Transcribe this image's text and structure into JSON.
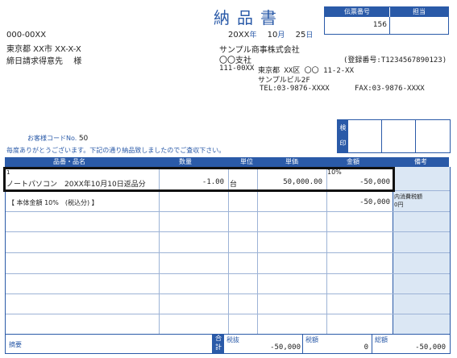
{
  "document": {
    "title": "納品書",
    "voucher": {
      "number_label": "伝票番号",
      "person_label": "担当",
      "number_value": "156"
    },
    "date": {
      "year": "20XX",
      "year_unit": "年",
      "month": "10",
      "month_unit": "月",
      "day": "25",
      "day_unit": "日"
    }
  },
  "recipient": {
    "postal": "000-00XX",
    "address": "東京都 XX市 XX-X-X",
    "name": "締日請求得意先",
    "honorific": "様"
  },
  "sender": {
    "company": "サンプル商事株式会社",
    "branch": "〇〇支社",
    "registration": "(登録番号:T1234567890123)",
    "postal": "111-00XX",
    "address_line1": "東京都 XX区 〇〇 11-2-XX",
    "address_line2": "サンプルビル2F",
    "tel": "TEL:03-9876-XXXX",
    "fax": "FAX:03-9876-XXXX"
  },
  "inspection": {
    "label_1": "検",
    "label_2": "印"
  },
  "customer_code": {
    "label": "お客様コードNo.",
    "value": "50"
  },
  "greeting": "毎度ありがとうございます。下記の通り納品致しましたのでご査収下さい。",
  "table": {
    "headers": {
      "item": "品番・品名",
      "quantity": "数量",
      "unit": "単位",
      "unit_price": "単価",
      "amount": "金額",
      "notes": "備考"
    },
    "rows": [
      {
        "line_no": "1",
        "name": "ノートパソコン　20XX年10月10日返品分",
        "quantity": "-1.00",
        "unit": "台",
        "unit_price": "50,000.00",
        "tax_rate": "10%",
        "amount": "-50,000"
      }
    ],
    "subtotal": {
      "label": "【 本体金額 10%　(税込分) 】",
      "amount": "-50,000",
      "note_1": "内消費税額",
      "note_2": "0円"
    }
  },
  "footer": {
    "remarks_label": "摘要",
    "total_label_1": "合",
    "total_label_2": "計",
    "net_label": "税抜",
    "net_value": "-50,000",
    "tax_label": "税額",
    "tax_value": "0",
    "gross_label": "総額",
    "gross_value": "-50,000"
  },
  "colors": {
    "accent": "#2a5aa8",
    "notes_bg": "#dbe7f4"
  }
}
